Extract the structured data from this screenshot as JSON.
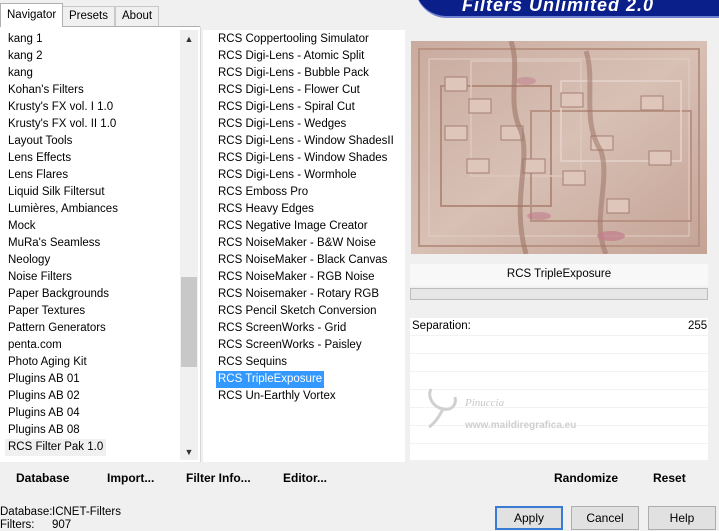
{
  "header": {
    "title": "Filters Unlimited 2.0"
  },
  "tabs": [
    {
      "label": "Navigator",
      "active": true
    },
    {
      "label": "Presets",
      "active": false
    },
    {
      "label": "About",
      "active": false
    }
  ],
  "categories": [
    "kang 1",
    "kang 2",
    "kang",
    "Kohan's Filters",
    "Krusty's FX vol. I 1.0",
    "Krusty's FX vol. II 1.0",
    "Layout Tools",
    "Lens Effects",
    "Lens Flares",
    "Liquid Silk Filtersut",
    "Lumières, Ambiances",
    "Mock",
    "MuRa's Seamless",
    "Neology",
    "Noise Filters",
    "Paper Backgrounds",
    "Paper Textures",
    "Pattern Generators",
    "penta.com",
    "Photo Aging Kit",
    "Plugins AB 01",
    "Plugins AB 02",
    "Plugins AB 04",
    "Plugins AB 08",
    "RCS Filter Pak 1.0"
  ],
  "selected_category": "RCS Filter Pak 1.0",
  "filters": [
    "RCS Coppertooling Simulator",
    "RCS Digi-Lens - Atomic Split",
    "RCS Digi-Lens - Bubble Pack",
    "RCS Digi-Lens - Flower Cut",
    "RCS Digi-Lens - Spiral Cut",
    "RCS Digi-Lens - Wedges",
    "RCS Digi-Lens - Window ShadesII",
    "RCS Digi-Lens - Window Shades",
    "RCS Digi-Lens - Wormhole",
    "RCS Emboss Pro",
    "RCS Heavy Edges",
    "RCS Negative Image Creator",
    "RCS NoiseMaker - B&W Noise",
    "RCS NoiseMaker - Black Canvas",
    "RCS NoiseMaker - RGB Noise",
    "RCS Noisemaker - Rotary RGB",
    "RCS Pencil Sketch Conversion",
    "RCS ScreenWorks - Grid",
    "RCS ScreenWorks - Paisley",
    "RCS Sequins",
    "RCS TripleExposure",
    "RCS Un-Earthly Vortex"
  ],
  "selected_filter": "RCS TripleExposure",
  "preview": {
    "filter_name": "RCS TripleExposure"
  },
  "params": [
    {
      "label": "Separation:",
      "value": "255"
    }
  ],
  "watermark": {
    "line1": "Pinuccia",
    "line2": "www.maildiregrafica.eu"
  },
  "bottom_buttons": {
    "database": "Database",
    "import": "Import...",
    "filter_info": "Filter Info...",
    "editor": "Editor..."
  },
  "right_buttons": {
    "randomize": "Randomize",
    "reset": "Reset"
  },
  "status": {
    "database_label": "Database:",
    "database_value": "ICNET-Filters",
    "filters_label": "Filters:",
    "filters_value": "907"
  },
  "dialog_buttons": {
    "apply": "Apply",
    "cancel": "Cancel",
    "help": "Help"
  },
  "colors": {
    "selection": "#3399ff",
    "banner": "#0a1f8a",
    "preview_tone": "#c8a99a"
  }
}
